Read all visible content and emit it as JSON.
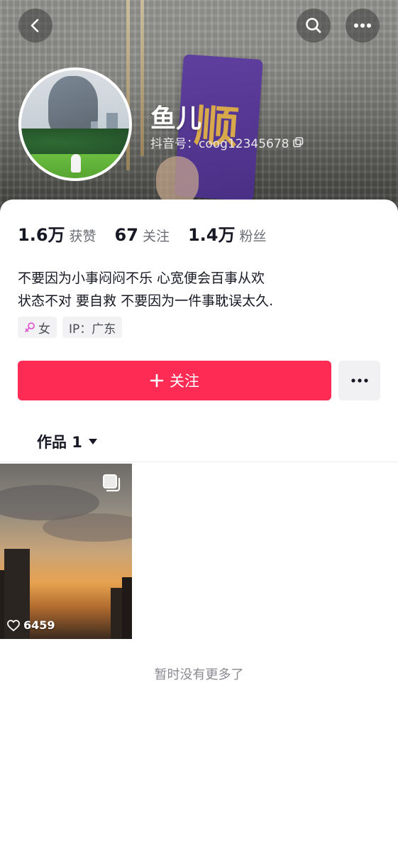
{
  "profile": {
    "nickname": "鱼儿",
    "douyin_id": "抖音号：coog12345678",
    "cover_card_glyph": "顺"
  },
  "stats": [
    {
      "value": "1.6万",
      "label": "获赞"
    },
    {
      "value": "67",
      "label": "关注"
    },
    {
      "value": "1.4万",
      "label": "粉丝"
    }
  ],
  "bio": {
    "line1": "不要因为小事闷闷不乐 心宽便会百事从欢",
    "line2": "状态不对 要自救 不要因为一件事耽误太久."
  },
  "tags": {
    "gender": "女",
    "ip": "IP：广东"
  },
  "actions": {
    "follow_label": "关注",
    "follow_icon": "plus-icon",
    "more_icon": "more-dots-icon"
  },
  "works": {
    "tab_label": "作品 1",
    "items": [
      {
        "likes": "6459",
        "type": "multi-image"
      }
    ],
    "empty_hint": "暂时没有更多了"
  },
  "colors": {
    "accent": "#fe2c55",
    "gender_icon": "#e05bd0"
  },
  "icons": {
    "back": "back-chevron-icon",
    "search": "search-icon",
    "more": "more-dots-icon",
    "copy": "copy-icon",
    "like": "heart-icon"
  }
}
